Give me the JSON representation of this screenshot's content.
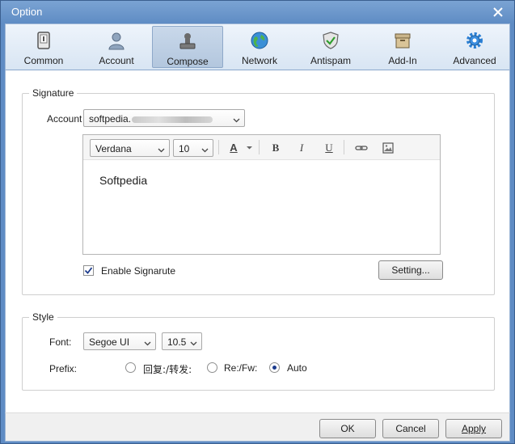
{
  "window": {
    "title": "Option"
  },
  "toolbar": {
    "tabs": [
      {
        "label": "Common",
        "icon": "phone-icon"
      },
      {
        "label": "Account",
        "icon": "user-icon"
      },
      {
        "label": "Compose",
        "icon": "stamp-icon",
        "active": true
      },
      {
        "label": "Network",
        "icon": "globe-icon"
      },
      {
        "label": "Antispam",
        "icon": "shield-icon"
      },
      {
        "label": "Add-In",
        "icon": "box-icon"
      },
      {
        "label": "Advanced",
        "icon": "gear-icon"
      }
    ]
  },
  "signature": {
    "group_title": "Signature",
    "account_label": "Account",
    "account_value": "softpedia.",
    "editor": {
      "font_value": "Verdana",
      "size_value": "10",
      "bold": "B",
      "italic": "I",
      "underline": "U",
      "font_color": "A",
      "body_text": "Softpedia"
    },
    "enable_label": "Enable Signarute",
    "enable_checked": true,
    "setting_button": "Setting..."
  },
  "style": {
    "group_title": "Style",
    "font_label": "Font:",
    "font_value": "Segoe UI",
    "size_value": "10.5",
    "prefix_label": "Prefix:",
    "prefix_options": [
      "回复:/转发:",
      "Re:/Fw:",
      "Auto"
    ],
    "prefix_selected": "Auto"
  },
  "footer": {
    "ok": "OK",
    "cancel": "Cancel",
    "apply": "Apply"
  },
  "colors": {
    "title_bar": "#5f8cc4",
    "accent_check": "#1c3b8c"
  }
}
